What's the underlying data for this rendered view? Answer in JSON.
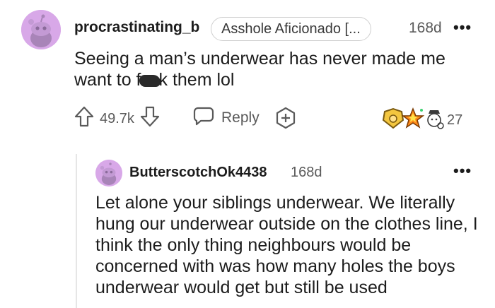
{
  "comment": {
    "username": "procrastinating_b",
    "flair": "Asshole Aficionado [...",
    "age": "168d",
    "more": "•••",
    "text_before": "Seeing a man’s underwear has never made me want to f",
    "text_after": "k them lol",
    "vote_count": "49.7k",
    "reply_label": "Reply",
    "award_count": "27",
    "icons": [
      "upvote-icon",
      "downvote-icon",
      "reply-bubble-icon",
      "add-award-icon",
      "award-icons"
    ]
  },
  "reply": {
    "username": "ButterscotchOk4438",
    "age": "168d",
    "more": "•••",
    "text": "Let alone your siblings underwear. We literally hung our underwear outside on the clothes line, I think the only thing neighbours would be concerned with was how many holes the boys underwear would get but still be used"
  },
  "colors": {
    "avatar_bg": "#d8a8e8",
    "text": "#1c1c1c",
    "meta": "#5a5a5a"
  }
}
